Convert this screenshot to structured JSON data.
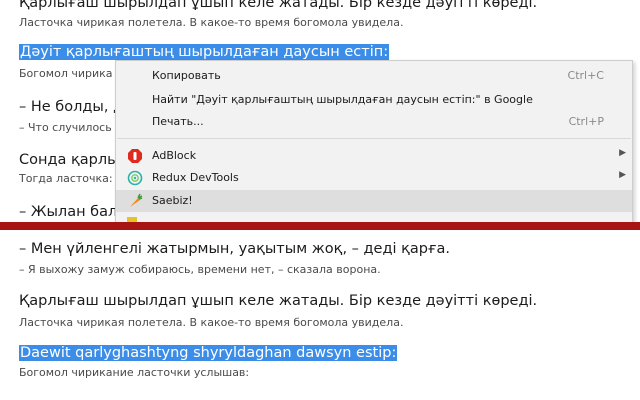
{
  "top_content": {
    "line1": "Қарлығаш шырылдап ұшып келе жатады. Бір кезде дәуітті көреді.",
    "line1_sub": "Ласточка чирикая полетела. В какое-то время богомола увидела.",
    "line2_selected": "Дәуіт қарлығаштың шырылдаған даусын естіп:",
    "line2_sub": "Богомол чирика",
    "line3": "– Не болды, д",
    "line3_sub": "– Что случилось",
    "line4": "Сонда қарлы",
    "line4_sub": "Тогда ласточка:",
    "line5": "– Жылан бала"
  },
  "context_menu": {
    "copy": {
      "label": "Копировать",
      "shortcut": "Ctrl+C"
    },
    "search": {
      "label": "Найти \"Дәуіт қарлығаштың шырылдаған даусын естіп:\" в Google"
    },
    "print": {
      "label": "Печать...",
      "shortcut": "Ctrl+P"
    },
    "extensions": [
      {
        "label": "AdBlock",
        "icon": "adblock-icon",
        "has_submenu": true
      },
      {
        "label": "Redux DevTools",
        "icon": "redux-devtools-icon",
        "has_submenu": true
      },
      {
        "label": "Saebiz!",
        "icon": "carrot-icon",
        "has_submenu": false
      }
    ]
  },
  "bottom_content": {
    "line1": "– Мен үйленгелі жатырмын, уақытым жоқ, – деді қарға.",
    "line1_sub": "– Я выхожу замуж собираюсь, времени нет, – сказала ворона.",
    "line2": "Қарлығаш шырылдап ұшып келе жатады. Бір кезде дәуітті көреді.",
    "line2_sub": "Ласточка чирикая полетела. В какое-то время богомола увидела.",
    "line3_selected": "Daewit qarlyghashtyng shyryldaghan dawsyn estip:",
    "line3_sub": "Богомол чирикание ласточки услышав:"
  },
  "colors": {
    "selection": "#3b8de8",
    "divider": "#a81313",
    "menu_bg": "#f2f2f2"
  }
}
